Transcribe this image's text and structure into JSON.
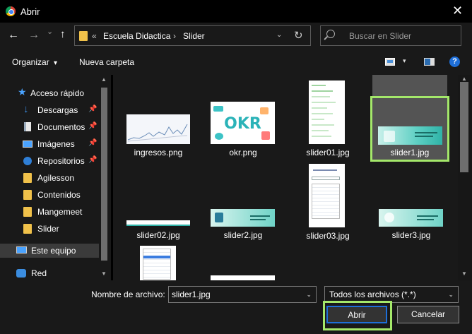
{
  "window": {
    "title": "Abrir",
    "close_glyph": "✕"
  },
  "nav": {
    "back_glyph": "←",
    "forward_glyph": "→",
    "recent_glyph": "⌄",
    "up_glyph": "🡡",
    "breadcrumb_overflow": "«",
    "path": [
      "Escuela Didactica",
      "Slider"
    ],
    "separator": "›",
    "dropdown_glyph": "⌄",
    "refresh_glyph": "↻",
    "search_placeholder": "Buscar en Slider"
  },
  "toolbar": {
    "organize_label": "Organizar",
    "organize_caret": "▾",
    "new_folder_label": "Nueva carpeta",
    "view_caret": "▾",
    "help_glyph": "?"
  },
  "sidebar": {
    "quick_access": "Acceso rápido",
    "items": [
      {
        "label": "Descargas",
        "icon": "download-icon",
        "pinned": true
      },
      {
        "label": "Documentos",
        "icon": "documents-icon",
        "pinned": true
      },
      {
        "label": "Imágenes",
        "icon": "pictures-icon",
        "pinned": true
      },
      {
        "label": "Repositorios",
        "icon": "repo-icon",
        "pinned": true
      },
      {
        "label": "Agilesson",
        "icon": "folder-icon",
        "pinned": false
      },
      {
        "label": "Contenidos",
        "icon": "folder-icon",
        "pinned": false
      },
      {
        "label": "Mangemeet",
        "icon": "folder-icon",
        "pinned": false
      },
      {
        "label": "Slider",
        "icon": "folder-icon",
        "pinned": false
      }
    ],
    "this_pc": "Este equipo",
    "network": "Red",
    "pin_glyph": "📌",
    "scroll_up_glyph": "▲",
    "scroll_down_glyph": "▼",
    "scroll_position": 0
  },
  "files": [
    {
      "name": "ingresos.png"
    },
    {
      "name": "okr.png",
      "thumb_text": "OKR"
    },
    {
      "name": "slider01.jpg"
    },
    {
      "name": "slider1.jpg",
      "selected": true
    },
    {
      "name": "slider02.jpg"
    },
    {
      "name": "slider2.jpg"
    },
    {
      "name": "slider03.jpg"
    },
    {
      "name": "slider3.jpg"
    }
  ],
  "footer": {
    "filename_label": "Nombre de archivo:",
    "filename_value": "slider1.jpg",
    "filter_value": "Todos los archivos (*.*)",
    "caret": "⌄",
    "open_label": "Abrir",
    "cancel_label": "Cancelar"
  },
  "colors": {
    "highlight": "#a4e86a",
    "accent": "#1e6fd9",
    "folder": "#f0c14a"
  }
}
